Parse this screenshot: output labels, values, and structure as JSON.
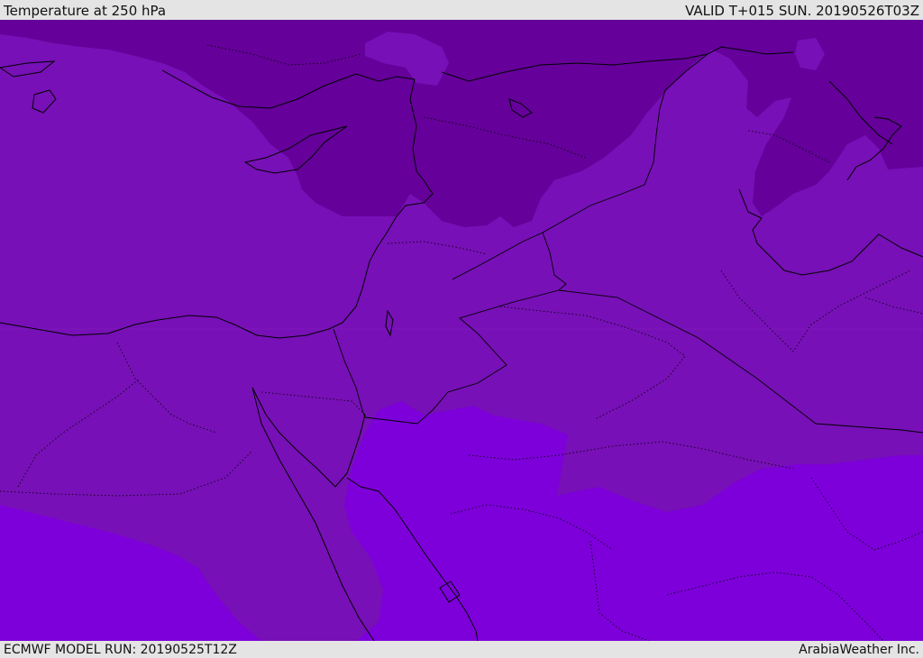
{
  "header": {
    "title": "Temperature at 250 hPa",
    "valid_time": "VALID T+015 SUN. 20190526T03Z"
  },
  "footer": {
    "model_run": "ECMWF MODEL RUN: 20190525T12Z",
    "credit": "ArabiaWeather Inc."
  },
  "map": {
    "field": "temperature",
    "level": "250 hPa",
    "colors": {
      "coldest": "#65009a",
      "mid": "#7710b6",
      "warmest": "#7d00da",
      "border": "#000000"
    }
  }
}
